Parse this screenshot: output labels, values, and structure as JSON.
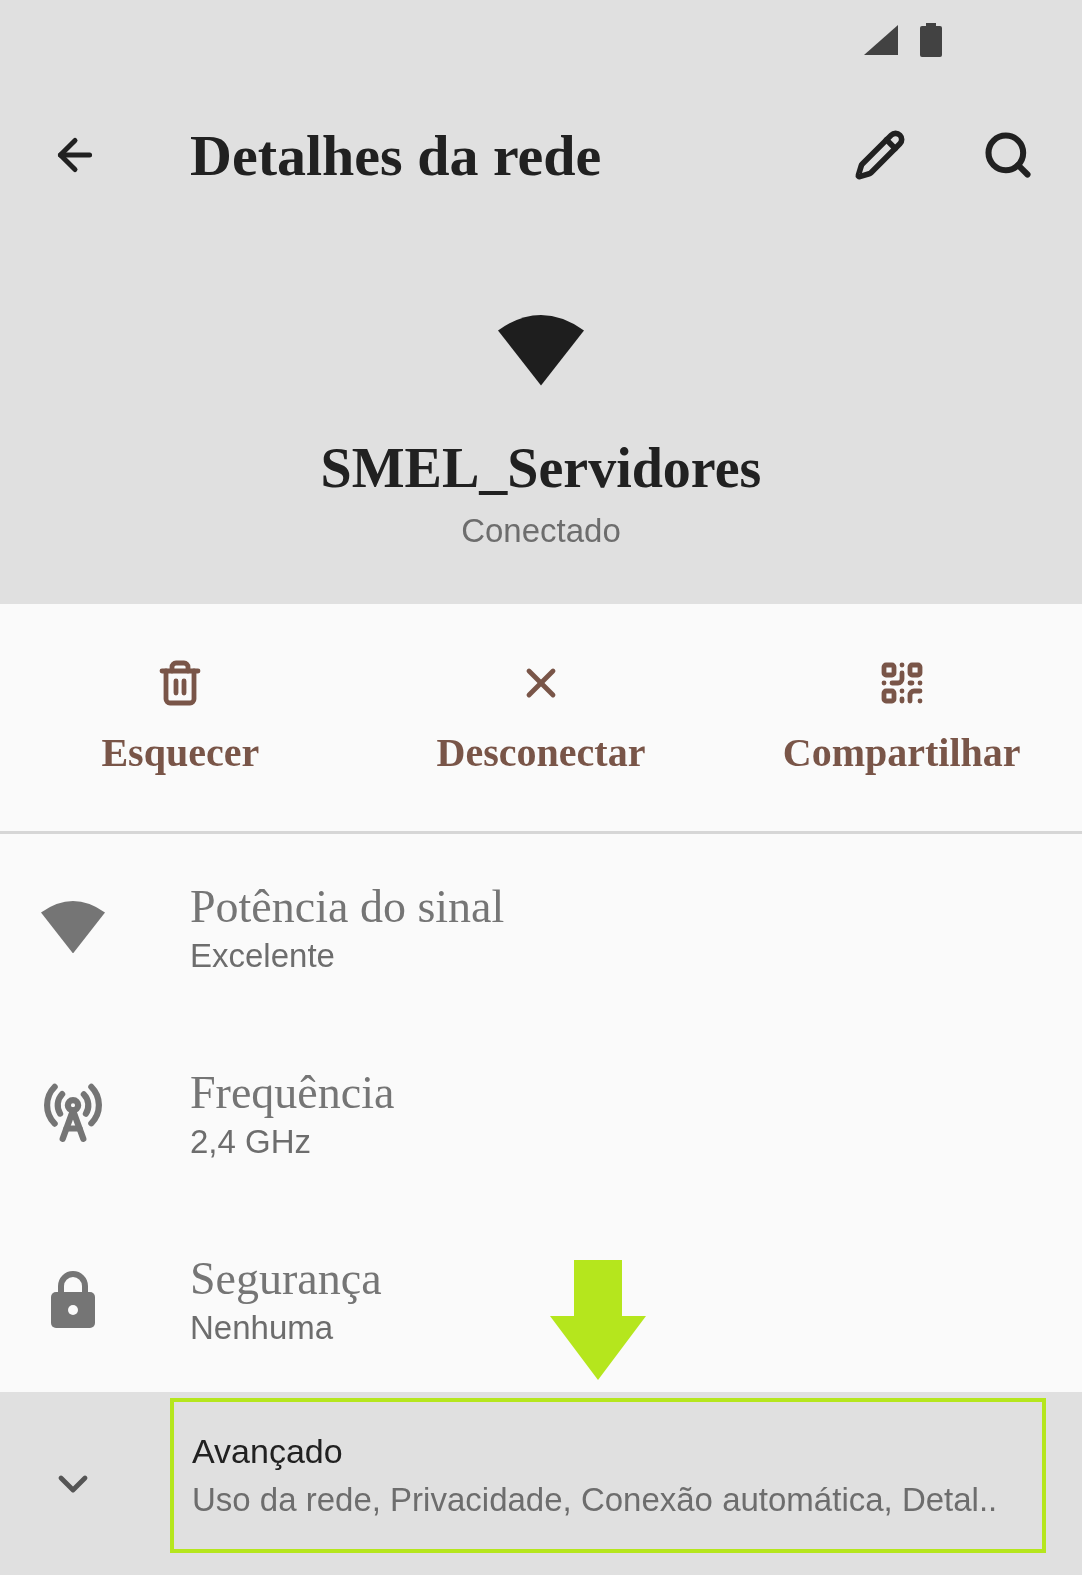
{
  "toolbar": {
    "title": "Detalhes da rede"
  },
  "network": {
    "name": "SMEL_Servidores",
    "status": "Conectado"
  },
  "actions": [
    {
      "kind": "forget",
      "label": "Esquecer"
    },
    {
      "kind": "disconnect",
      "label": "Desconectar"
    },
    {
      "kind": "share",
      "label": "Compartilhar"
    }
  ],
  "details": [
    {
      "kind": "signal",
      "title": "Potência do sinal",
      "value": "Excelente"
    },
    {
      "kind": "frequency",
      "title": "Frequência",
      "value": "2,4 GHz"
    },
    {
      "kind": "security",
      "title": "Segurança",
      "value": "Nenhuma"
    }
  ],
  "advanced": {
    "title": "Avançado",
    "summary": "Uso da rede, Privacidade, Conexão automática, Detal..",
    "expanded": false,
    "highlighted": true
  }
}
